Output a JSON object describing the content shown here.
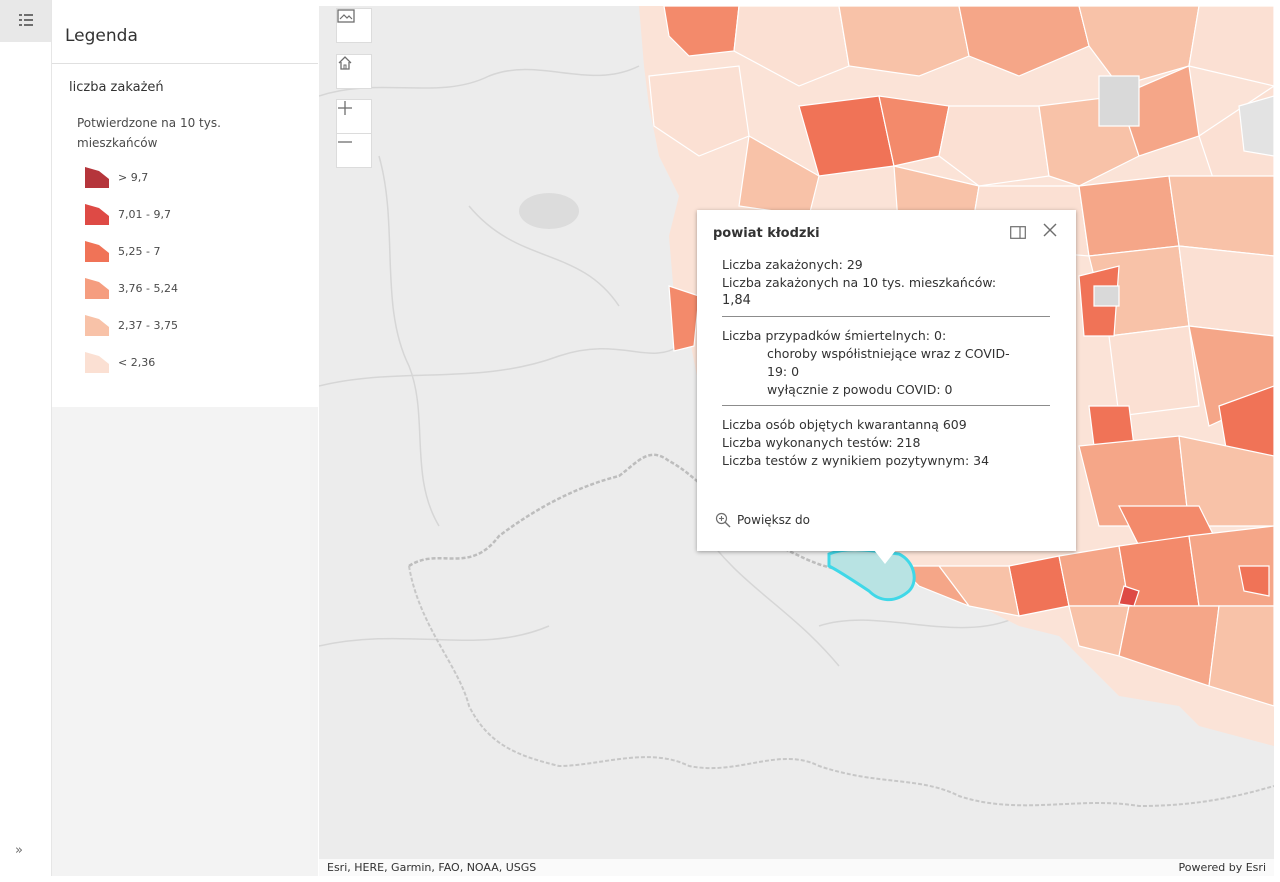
{
  "legend": {
    "title": "Legenda",
    "layer_name": "liczba zakażeń",
    "field_name": "Potwierdzone na 10 tys. mieszkańców",
    "classes": [
      {
        "label": "> 9,7",
        "color": "#b5353b"
      },
      {
        "label": "7,01 - 9,7",
        "color": "#de4a45"
      },
      {
        "label": "5,25 - 7",
        "color": "#f07357"
      },
      {
        "label": "3,76 - 5,24",
        "color": "#f59d7f"
      },
      {
        "label": "2,37 - 3,75",
        "color": "#f8c2a8"
      },
      {
        "label": "< 2,36",
        "color": "#fbe0d3"
      }
    ]
  },
  "popup": {
    "title": "powiat kłodzki",
    "cases_label": "Liczba zakażonych: 29",
    "cases_per10k_label": "Liczba zakażonych na 10 tys. mieszkańców:",
    "cases_per10k_value": "1,84",
    "deaths_label": "Liczba przypadków śmiertelnych: 0:",
    "deaths_comorb_1": "choroby współistniejące wraz z COVID-",
    "deaths_comorb_2": "19: 0",
    "deaths_covid_only": "wyłącznie z powodu COVID: 0",
    "quarantine_label": "Liczba osób objętych kwarantanną 609",
    "tests_label": "Liczba wykonanych testów: 218",
    "positive_tests_label": "Liczba testów z wynikiem pozytywnym: 34",
    "zoom_label": "Powiększ do"
  },
  "map": {
    "attribution": "Esri, HERE, Garmin, FAO, NOAA, USGS",
    "powered_by": "Powered by Esri",
    "highlight_color": "#3fd8e8",
    "base_color": "#ececec"
  }
}
